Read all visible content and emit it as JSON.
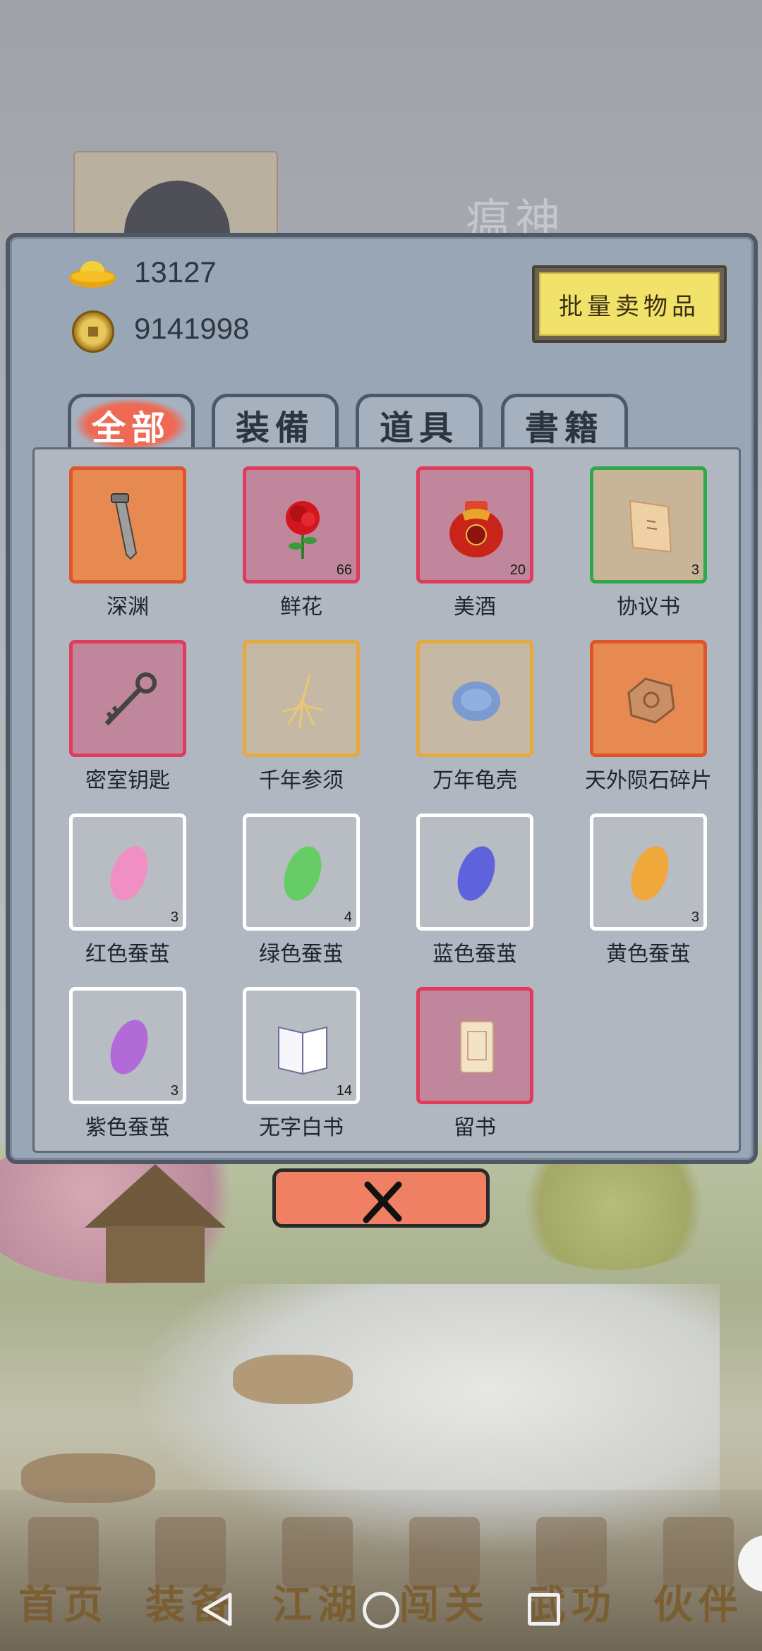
{
  "background": {
    "character_name": "瘟神"
  },
  "currency": {
    "gold": "13127",
    "coins": "9141998"
  },
  "bulk_sell_label": "批量卖物品",
  "tabs": [
    {
      "label": "全部",
      "active": true
    },
    {
      "label": "装備",
      "active": false
    },
    {
      "label": "道具",
      "active": false
    },
    {
      "label": "書籍",
      "active": false
    }
  ],
  "items": [
    {
      "name": "深渊",
      "count": "",
      "rarity": "orange",
      "icon": "sword-icon"
    },
    {
      "name": "鲜花",
      "count": "66",
      "rarity": "red",
      "icon": "rose-icon"
    },
    {
      "name": "美酒",
      "count": "20",
      "rarity": "red",
      "icon": "wine-jar-icon"
    },
    {
      "name": "协议书",
      "count": "3",
      "rarity": "green",
      "icon": "document-icon"
    },
    {
      "name": "密室钥匙",
      "count": "",
      "rarity": "red",
      "icon": "key-icon"
    },
    {
      "name": "千年参须",
      "count": "",
      "rarity": "gold",
      "icon": "ginseng-icon"
    },
    {
      "name": "万年龟壳",
      "count": "",
      "rarity": "gold",
      "icon": "tortoise-shell-icon"
    },
    {
      "name": "天外陨石碎片",
      "count": "",
      "rarity": "orange",
      "icon": "meteorite-icon"
    },
    {
      "name": "红色蚕茧",
      "count": "3",
      "rarity": "white",
      "icon": "cocoon-icon",
      "color": "#f08fc4"
    },
    {
      "name": "绿色蚕茧",
      "count": "4",
      "rarity": "white",
      "icon": "cocoon-icon",
      "color": "#66cc66"
    },
    {
      "name": "蓝色蚕茧",
      "count": "",
      "rarity": "white",
      "icon": "cocoon-icon",
      "color": "#5e62dc"
    },
    {
      "name": "黄色蚕茧",
      "count": "3",
      "rarity": "white",
      "icon": "cocoon-icon",
      "color": "#f0a83a"
    },
    {
      "name": "紫色蚕茧",
      "count": "3",
      "rarity": "white",
      "icon": "cocoon-icon",
      "color": "#b16ad8"
    },
    {
      "name": "无字白书",
      "count": "14",
      "rarity": "white",
      "icon": "book-icon"
    },
    {
      "name": "留书",
      "count": "",
      "rarity": "red",
      "icon": "letter-icon"
    }
  ],
  "bottom_nav": [
    {
      "label": "首页"
    },
    {
      "label": "装备"
    },
    {
      "label": "江湖"
    },
    {
      "label": "闯关"
    },
    {
      "label": "武功"
    },
    {
      "label": "伙伴"
    }
  ]
}
